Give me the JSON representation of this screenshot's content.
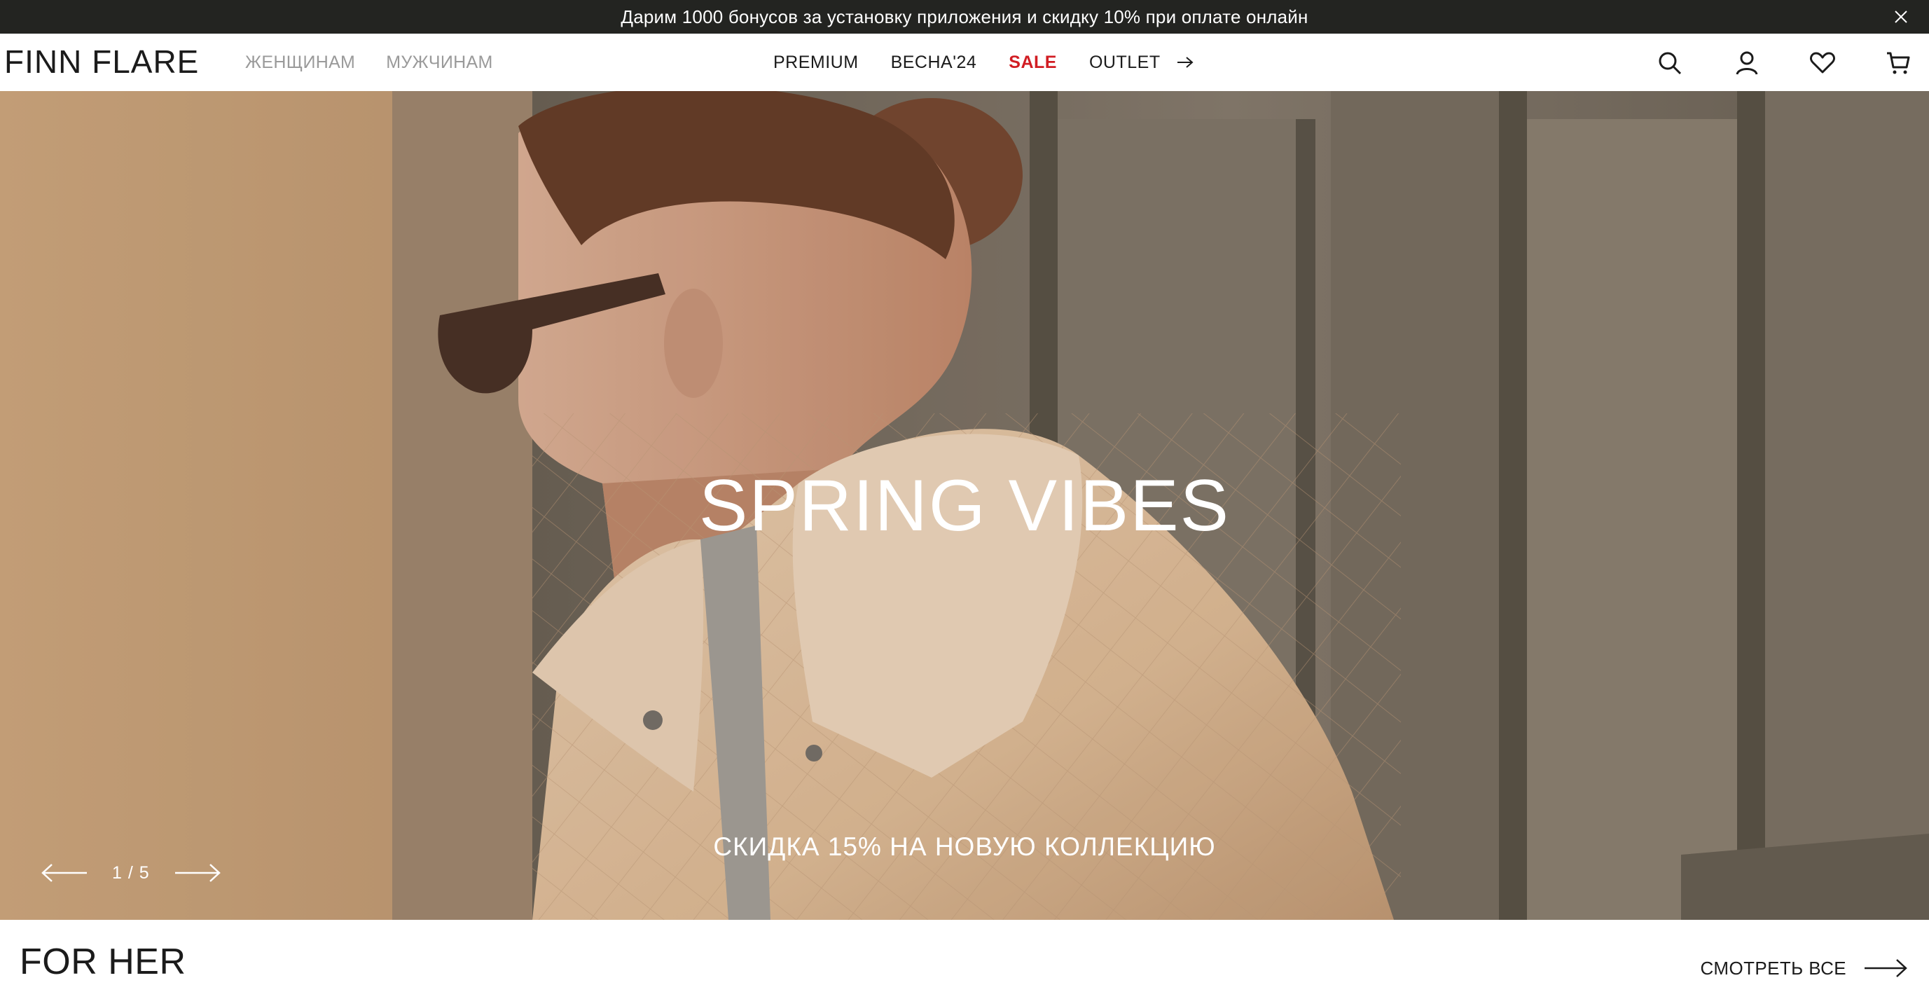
{
  "promo": {
    "text": "Дарим 1000 бонусов за установку приложения и скидку 10% при оплате онлайн",
    "close_icon": "close-icon"
  },
  "header": {
    "logo": "FINN FLARE",
    "gender_nav": [
      "ЖЕНЩИНАМ",
      "МУЖЧИНАМ"
    ],
    "main_nav": {
      "premium": "PREMIUM",
      "spring": "ВЕСНА'24",
      "sale": "SALE",
      "outlet": "OUTLET"
    },
    "icons": [
      "search-icon",
      "user-icon",
      "heart-icon",
      "cart-icon"
    ]
  },
  "hero": {
    "title": "SPRING VIBES",
    "subtitle": "СКИДКА 15% НА НОВУЮ КОЛЛЕКЦИЮ",
    "counter": "1 / 5"
  },
  "section": {
    "title": "FOR HER",
    "see_all": "СМОТРЕТЬ ВСЕ"
  },
  "colors": {
    "promo_bg": "#232421",
    "sale": "#d11d23",
    "muted_nav": "#9a9a9a",
    "text": "#1b1b1b"
  }
}
